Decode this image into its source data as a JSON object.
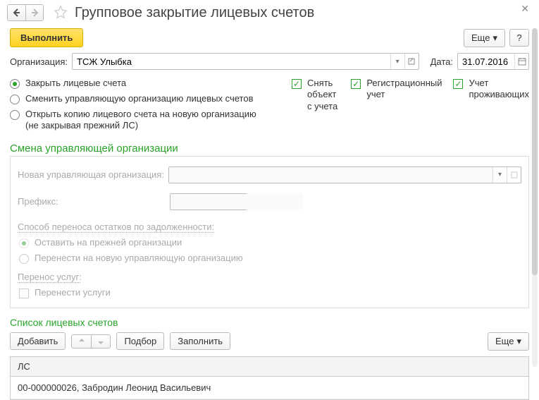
{
  "header": {
    "title": "Групповое закрытие лицевых счетов"
  },
  "toolbar": {
    "execute": "Выполнить",
    "more": "Еще",
    "help": "?"
  },
  "fields": {
    "org_label": "Организация:",
    "org_value": "ТСЖ Улыбка",
    "date_label": "Дата:",
    "date_value": "31.07.2016"
  },
  "radios": {
    "close": "Закрыть лицевые счета",
    "change": "Сменить управляющую организацию лицевых счетов",
    "open_copy_l1": "Открыть копию лицевого счета на новую организацию",
    "open_copy_l2": "(не закрывая прежний ЛС)"
  },
  "checks": {
    "deregister_l1": "Снять объект",
    "deregister_l2": "с учета",
    "reg_l1": "Регистрационный",
    "reg_l2": "учет",
    "residents_l1": "Учет",
    "residents_l2": "проживающих"
  },
  "change_section": {
    "title": "Смена управляющей организации",
    "new_org_label": "Новая управляющая организация:",
    "prefix_label": "Префикс:",
    "balance_title": "Способ переноса остатков по задолженности:",
    "leave": "Оставить на прежней организации",
    "move": "Перенести на новую управляющую организацию",
    "services_title": "Перенос услуг:",
    "services_check": "Перенести услуги"
  },
  "list_section": {
    "title": "Список лицевых счетов",
    "add": "Добавить",
    "pick": "Подбор",
    "fill": "Заполнить",
    "more": "Еще",
    "col_header": "ЛС",
    "rows": [
      "00-000000026, Забродин Леонид Васильевич"
    ]
  }
}
